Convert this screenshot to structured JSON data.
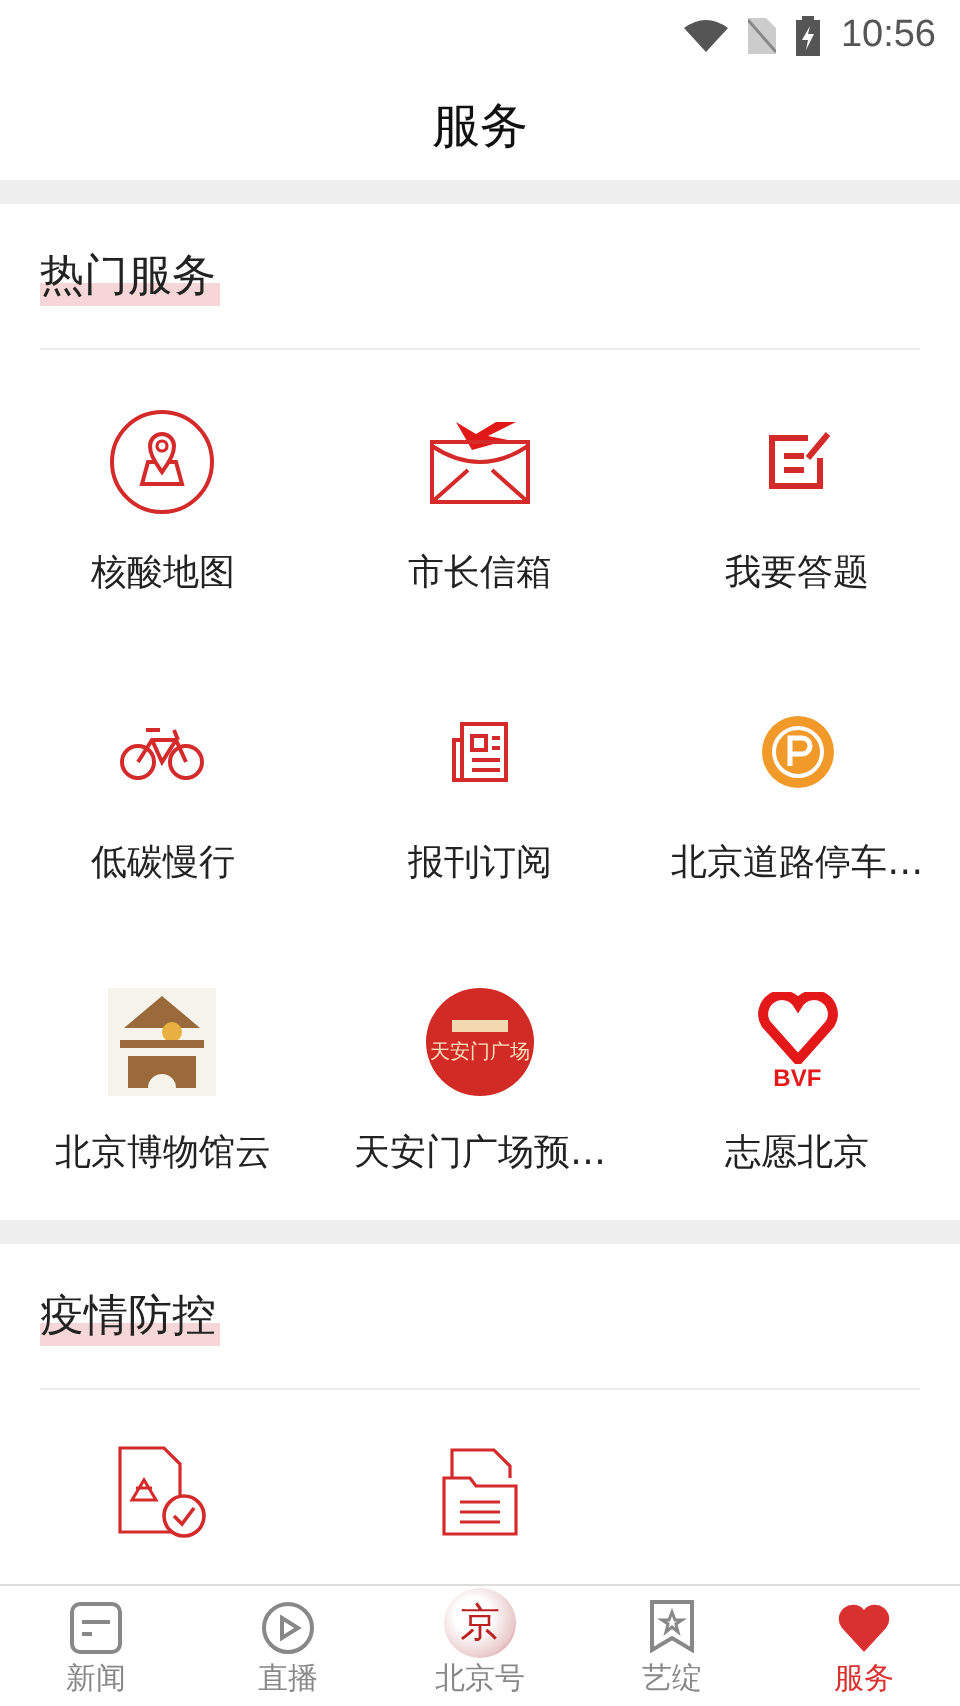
{
  "status_bar": {
    "time": "10:56"
  },
  "header": {
    "title": "服务"
  },
  "sections": [
    {
      "title": "热门服务",
      "items": [
        {
          "kind": "map",
          "label": "核酸地图"
        },
        {
          "kind": "mail",
          "label": "市长信箱"
        },
        {
          "kind": "edit",
          "label": "我要答题"
        },
        {
          "kind": "bike",
          "label": "低碳慢行"
        },
        {
          "kind": "paper",
          "label": "报刊订阅"
        },
        {
          "kind": "parking",
          "label": "北京道路停车…"
        },
        {
          "kind": "museum",
          "label": "北京博物馆云"
        },
        {
          "kind": "tiananmen",
          "label": "天安门广场预…",
          "logo_text": "天安门广场"
        },
        {
          "kind": "volunteer",
          "label": "志愿北京",
          "logo_text": "BVF"
        }
      ]
    },
    {
      "title": "疫情防控",
      "items": [
        {
          "kind": "health-doc"
        },
        {
          "kind": "folder"
        }
      ]
    }
  ],
  "tabs": [
    {
      "kind": "news",
      "label": "新闻",
      "selected": false
    },
    {
      "kind": "live",
      "label": "直播",
      "selected": false
    },
    {
      "kind": "logo",
      "label": "北京号",
      "logo_text": "京",
      "selected": false
    },
    {
      "kind": "bookmark",
      "label": "艺绽",
      "selected": false
    },
    {
      "kind": "heart",
      "label": "服务",
      "selected": true
    }
  ]
}
